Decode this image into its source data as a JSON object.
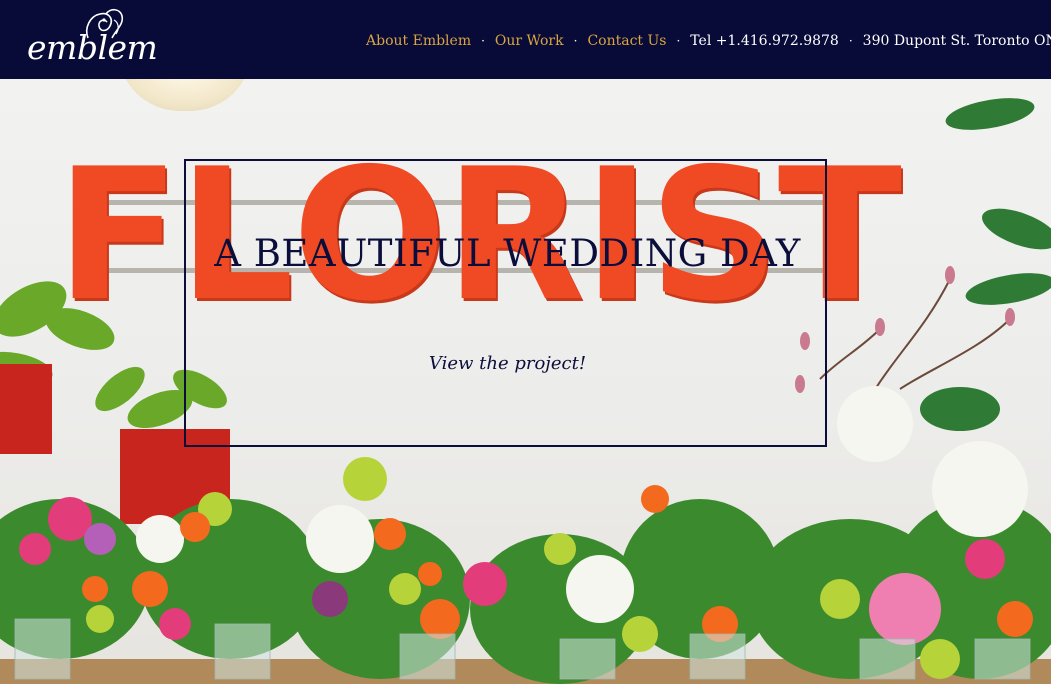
{
  "header": {
    "logo_text": "emblem"
  },
  "nav": {
    "items": [
      {
        "label": "About Emblem"
      },
      {
        "label": "Our Work"
      },
      {
        "label": "Contact Us"
      }
    ],
    "separator": "·",
    "phone": "Tel +1.416.972.9878",
    "address": "390 Dupont St. Toronto ON"
  },
  "hero": {
    "sign_letters": [
      "F",
      "L",
      "O",
      "R",
      "I",
      "S",
      "T"
    ],
    "title": "A BEAUTIFUL WEDDING DAY",
    "link_label": "View the project!"
  },
  "colors": {
    "header_bg": "#080b38",
    "nav_link": "#d9a441",
    "sign_orange": "#ef4a24",
    "hero_text": "#0b0e3b"
  }
}
